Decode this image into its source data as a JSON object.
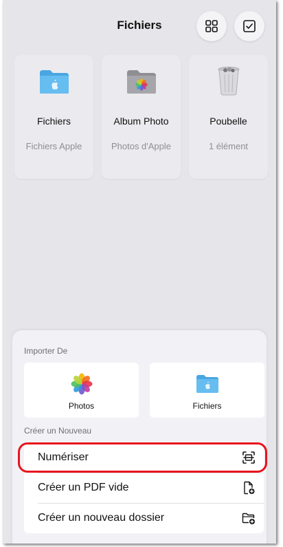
{
  "header": {
    "title": "Fichiers"
  },
  "locations": [
    {
      "name": "Fichiers",
      "subtitle": "Fichiers Apple",
      "icon": "apple-folder-icon"
    },
    {
      "name": "Album Photo",
      "subtitle": "Photos d'Apple",
      "icon": "photos-folder-icon"
    },
    {
      "name": "Poubelle",
      "subtitle": "1 élément",
      "icon": "trash-icon"
    }
  ],
  "sheet": {
    "import_label": "Importer De",
    "import_options": [
      {
        "label": "Photos",
        "icon": "photos-app-icon"
      },
      {
        "label": "Fichiers",
        "icon": "files-folder-icon"
      }
    ],
    "create_label": "Créer un Nouveau",
    "create_options": [
      {
        "label": "Numériser",
        "icon": "scan-icon"
      },
      {
        "label": "Créer un PDF vide",
        "icon": "new-document-icon"
      },
      {
        "label": "Créer un nouveau dossier",
        "icon": "new-folder-icon"
      }
    ]
  },
  "colors": {
    "highlight": "#e8141c",
    "folder_blue": "#5ab4ea",
    "background": "#e6e6ea"
  }
}
